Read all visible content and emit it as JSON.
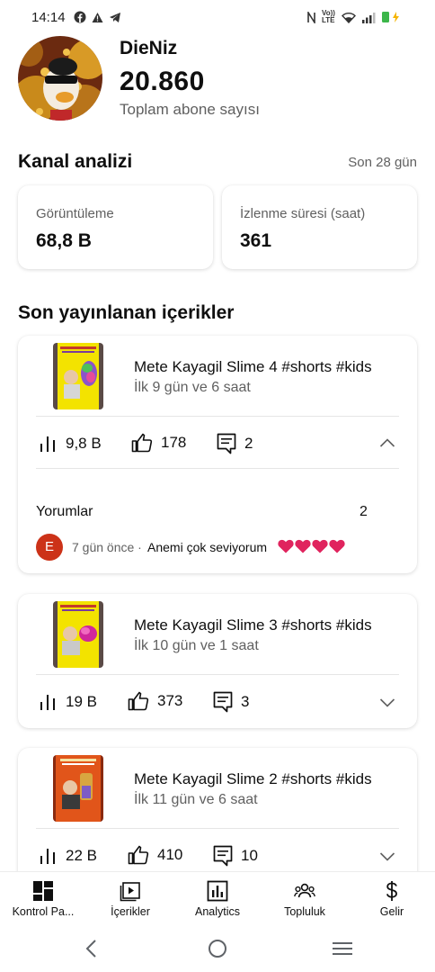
{
  "status_bar": {
    "time": "14:14",
    "network": "Vo)) LTE"
  },
  "channel": {
    "name": "DieNiz",
    "subscribers": "20.860",
    "subscribers_label": "Toplam abone sayısı"
  },
  "analytics": {
    "title": "Kanal analizi",
    "period": "Son 28 gün",
    "views_label": "Görüntüleme",
    "views_value": "68,8 B",
    "watch_label": "İzlenme süresi (saat)",
    "watch_value": "361"
  },
  "recent": {
    "title": "Son yayınlanan içerikler",
    "videos": [
      {
        "title": "Mete Kayagil Slime 4 #shorts #kids",
        "age": "İlk 9 gün ve 6 saat",
        "views": "9,8 B",
        "likes": "178",
        "comments": "2",
        "expanded": true,
        "comments_label": "Yorumlar",
        "comments_count": "2",
        "top_comment": {
          "avatar_letter": "E",
          "time": "7 gün önce ·",
          "text": "Anemi çok seviyorum",
          "emoji_hearts": 4
        }
      },
      {
        "title": "Mete Kayagil Slime 3 #shorts #kids",
        "age": "İlk 10 gün ve 1 saat",
        "views": "19 B",
        "likes": "373",
        "comments": "3",
        "expanded": false
      },
      {
        "title": "Mete Kayagil Slime 2 #shorts #kids",
        "age": "İlk 11 gün ve 6 saat",
        "views": "22 B",
        "likes": "410",
        "comments": "10",
        "expanded": false
      }
    ]
  },
  "bottom_nav": [
    {
      "label": "Kontrol Pa...",
      "icon": "dashboard-icon"
    },
    {
      "label": "İçerikler",
      "icon": "content-icon"
    },
    {
      "label": "Analytics",
      "icon": "analytics-icon"
    },
    {
      "label": "Topluluk",
      "icon": "community-icon"
    },
    {
      "label": "Gelir",
      "icon": "dollar-icon"
    }
  ],
  "colors": {
    "text": "#0f0f0f",
    "secondary": "#606060",
    "divider": "#e5e5e5",
    "comment_avatar": "#cc3218",
    "heart": "#e0245e"
  }
}
